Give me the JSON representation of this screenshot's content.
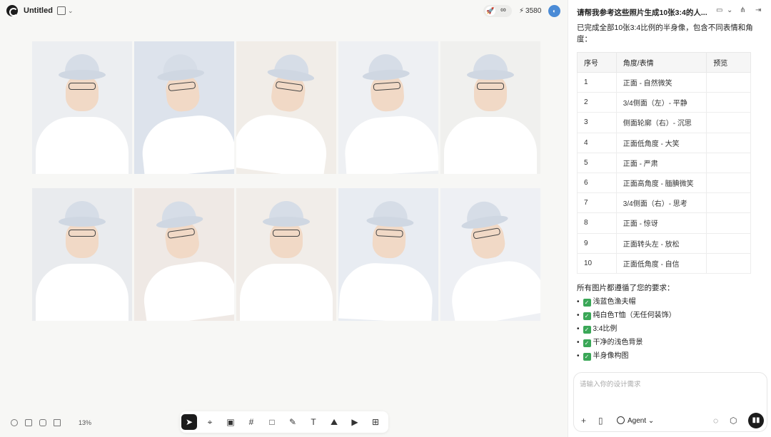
{
  "header": {
    "title": "Untitled",
    "infinity": "∞",
    "credits": "3580",
    "avatar_initial": "◐"
  },
  "canvas": {
    "zoom": "13%",
    "photos": [
      {
        "bg": "#eceef1",
        "tilt": 0
      },
      {
        "bg": "#dde3ec",
        "tilt": -6
      },
      {
        "bg": "#f1ede8",
        "tilt": 8
      },
      {
        "bg": "#eef0f3",
        "tilt": -4
      },
      {
        "bg": "#f0f0ee",
        "tilt": 0
      },
      {
        "bg": "#e9ebee",
        "tilt": 0
      },
      {
        "bg": "#efe9e5",
        "tilt": -8
      },
      {
        "bg": "#f1ede9",
        "tilt": 0
      },
      {
        "bg": "#e8ecf2",
        "tilt": 3
      },
      {
        "bg": "#eef0f4",
        "tilt": -10
      }
    ]
  },
  "toolbar": {
    "tools": [
      {
        "name": "select-tool",
        "glyph": "➤"
      },
      {
        "name": "pin-tool",
        "glyph": "⌖"
      },
      {
        "name": "image-tool",
        "glyph": "▣"
      },
      {
        "name": "frame-tool",
        "glyph": "#"
      },
      {
        "name": "rectangle-tool",
        "glyph": "□"
      },
      {
        "name": "pen-tool",
        "glyph": "✎"
      },
      {
        "name": "text-tool",
        "glyph": "T"
      },
      {
        "name": "image-gen-tool",
        "glyph": "⛰"
      },
      {
        "name": "video-gen-tool",
        "glyph": "▶"
      },
      {
        "name": "add-frame-tool",
        "glyph": "⊞"
      }
    ]
  },
  "panel": {
    "title": "请帮我参考这些照片生成10张3:4的人...",
    "intro": "已完成全部10张3:4比例的半身像，包含不同表情和角度：",
    "table": {
      "headers": [
        "序号",
        "角度/表情",
        "预览"
      ],
      "rows": [
        [
          "1",
          "正面 - 自然微笑",
          ""
        ],
        [
          "2",
          "3/4侧面（左）- 平静",
          ""
        ],
        [
          "3",
          "侧面轮廓（右）- 沉思",
          ""
        ],
        [
          "4",
          "正面低角度 - 大笑",
          ""
        ],
        [
          "5",
          "正面 - 严肃",
          ""
        ],
        [
          "6",
          "正面高角度 - 腼腆微笑",
          ""
        ],
        [
          "7",
          "3/4侧面（右）- 思考",
          ""
        ],
        [
          "8",
          "正面 - 惊讶",
          ""
        ],
        [
          "9",
          "正面转头左 - 放松",
          ""
        ],
        [
          "10",
          "正面低角度 - 自信",
          ""
        ]
      ]
    },
    "requirements_title": "所有图片都遵循了您的要求：",
    "requirements": [
      "浅蓝色渔夫帽",
      "纯白色T恤（无任何装饰）",
      "3:4比例",
      "干净的浅色背景",
      "半身像构图"
    ],
    "input_placeholder": "请输入你的设计需求",
    "agent_label": "Agent"
  }
}
